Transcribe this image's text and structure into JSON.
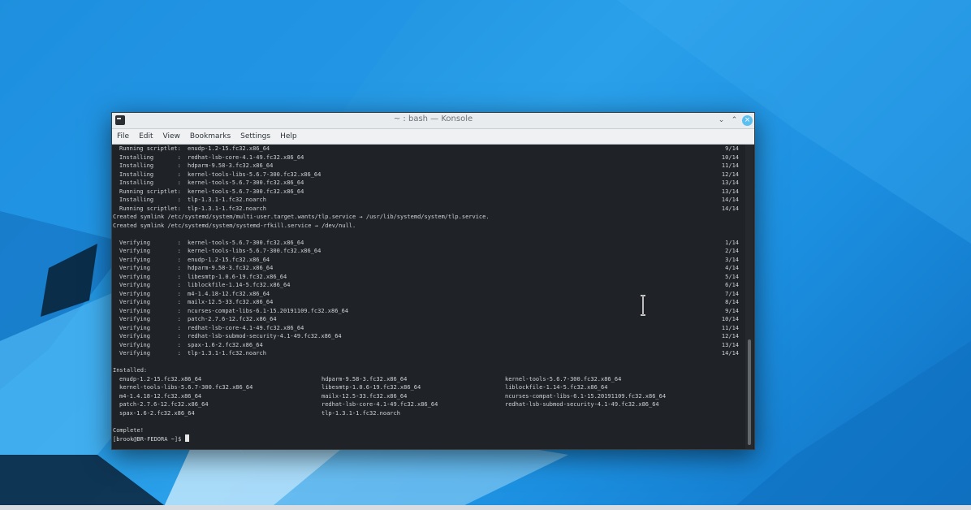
{
  "window": {
    "title": "~ : bash — Konsole",
    "menu": [
      "File",
      "Edit",
      "View",
      "Bookmarks",
      "Settings",
      "Help"
    ]
  },
  "terminal": {
    "transaction_lines": [
      {
        "action": "Running scriptlet:",
        "pkg": "enudp-1.2-15.fc32.x86_64",
        "count": "9/14"
      },
      {
        "action": "Installing       :",
        "pkg": "redhat-lsb-core-4.1-49.fc32.x86_64",
        "count": "10/14"
      },
      {
        "action": "Installing       :",
        "pkg": "hdparm-9.58-3.fc32.x86_64",
        "count": "11/14"
      },
      {
        "action": "Installing       :",
        "pkg": "kernel-tools-libs-5.6.7-300.fc32.x86_64",
        "count": "12/14"
      },
      {
        "action": "Installing       :",
        "pkg": "kernel-tools-5.6.7-300.fc32.x86_64",
        "count": "13/14"
      },
      {
        "action": "Running scriptlet:",
        "pkg": "kernel-tools-5.6.7-300.fc32.x86_64",
        "count": "13/14"
      },
      {
        "action": "Installing       :",
        "pkg": "tlp-1.3.1-1.fc32.noarch",
        "count": "14/14"
      },
      {
        "action": "Running scriptlet:",
        "pkg": "tlp-1.3.1-1.fc32.noarch",
        "count": "14/14"
      }
    ],
    "symlink_lines": [
      "Created symlink /etc/systemd/system/multi-user.target.wants/tlp.service → /usr/lib/systemd/system/tlp.service.",
      "Created symlink /etc/systemd/system/systemd-rfkill.service → /dev/null."
    ],
    "verify_lines": [
      {
        "action": "Verifying        :",
        "pkg": "kernel-tools-5.6.7-300.fc32.x86_64",
        "count": "1/14"
      },
      {
        "action": "Verifying        :",
        "pkg": "kernel-tools-libs-5.6.7-300.fc32.x86_64",
        "count": "2/14"
      },
      {
        "action": "Verifying        :",
        "pkg": "enudp-1.2-15.fc32.x86_64",
        "count": "3/14"
      },
      {
        "action": "Verifying        :",
        "pkg": "hdparm-9.58-3.fc32.x86_64",
        "count": "4/14"
      },
      {
        "action": "Verifying        :",
        "pkg": "libesmtp-1.0.6-19.fc32.x86_64",
        "count": "5/14"
      },
      {
        "action": "Verifying        :",
        "pkg": "liblockfile-1.14-5.fc32.x86_64",
        "count": "6/14"
      },
      {
        "action": "Verifying        :",
        "pkg": "m4-1.4.18-12.fc32.x86_64",
        "count": "7/14"
      },
      {
        "action": "Verifying        :",
        "pkg": "mailx-12.5-33.fc32.x86_64",
        "count": "8/14"
      },
      {
        "action": "Verifying        :",
        "pkg": "ncurses-compat-libs-6.1-15.20191109.fc32.x86_64",
        "count": "9/14"
      },
      {
        "action": "Verifying        :",
        "pkg": "patch-2.7.6-12.fc32.x86_64",
        "count": "10/14"
      },
      {
        "action": "Verifying        :",
        "pkg": "redhat-lsb-core-4.1-49.fc32.x86_64",
        "count": "11/14"
      },
      {
        "action": "Verifying        :",
        "pkg": "redhat-lsb-submod-security-4.1-49.fc32.x86_64",
        "count": "12/14"
      },
      {
        "action": "Verifying        :",
        "pkg": "spax-1.6-2.fc32.x86_64",
        "count": "13/14"
      },
      {
        "action": "Verifying        :",
        "pkg": "tlp-1.3.1-1.fc32.noarch",
        "count": "14/14"
      }
    ],
    "installed_header": "Installed:",
    "installed_rows": [
      [
        "enudp-1.2-15.fc32.x86_64",
        "hdparm-9.58-3.fc32.x86_64",
        "kernel-tools-5.6.7-300.fc32.x86_64"
      ],
      [
        "kernel-tools-libs-5.6.7-300.fc32.x86_64",
        "libesmtp-1.0.6-19.fc32.x86_64",
        "liblockfile-1.14-5.fc32.x86_64"
      ],
      [
        "m4-1.4.18-12.fc32.x86_64",
        "mailx-12.5-33.fc32.x86_64",
        "ncurses-compat-libs-6.1-15.20191109.fc32.x86_64"
      ],
      [
        "patch-2.7.6-12.fc32.x86_64",
        "redhat-lsb-core-4.1-49.fc32.x86_64",
        "redhat-lsb-submod-security-4.1-49.fc32.x86_64"
      ],
      [
        "spax-1.6-2.fc32.x86_64",
        "tlp-1.3.1-1.fc32.noarch",
        ""
      ]
    ],
    "complete": "Complete!",
    "prompt": "[brook@BR-FEDORA ~]$ "
  }
}
